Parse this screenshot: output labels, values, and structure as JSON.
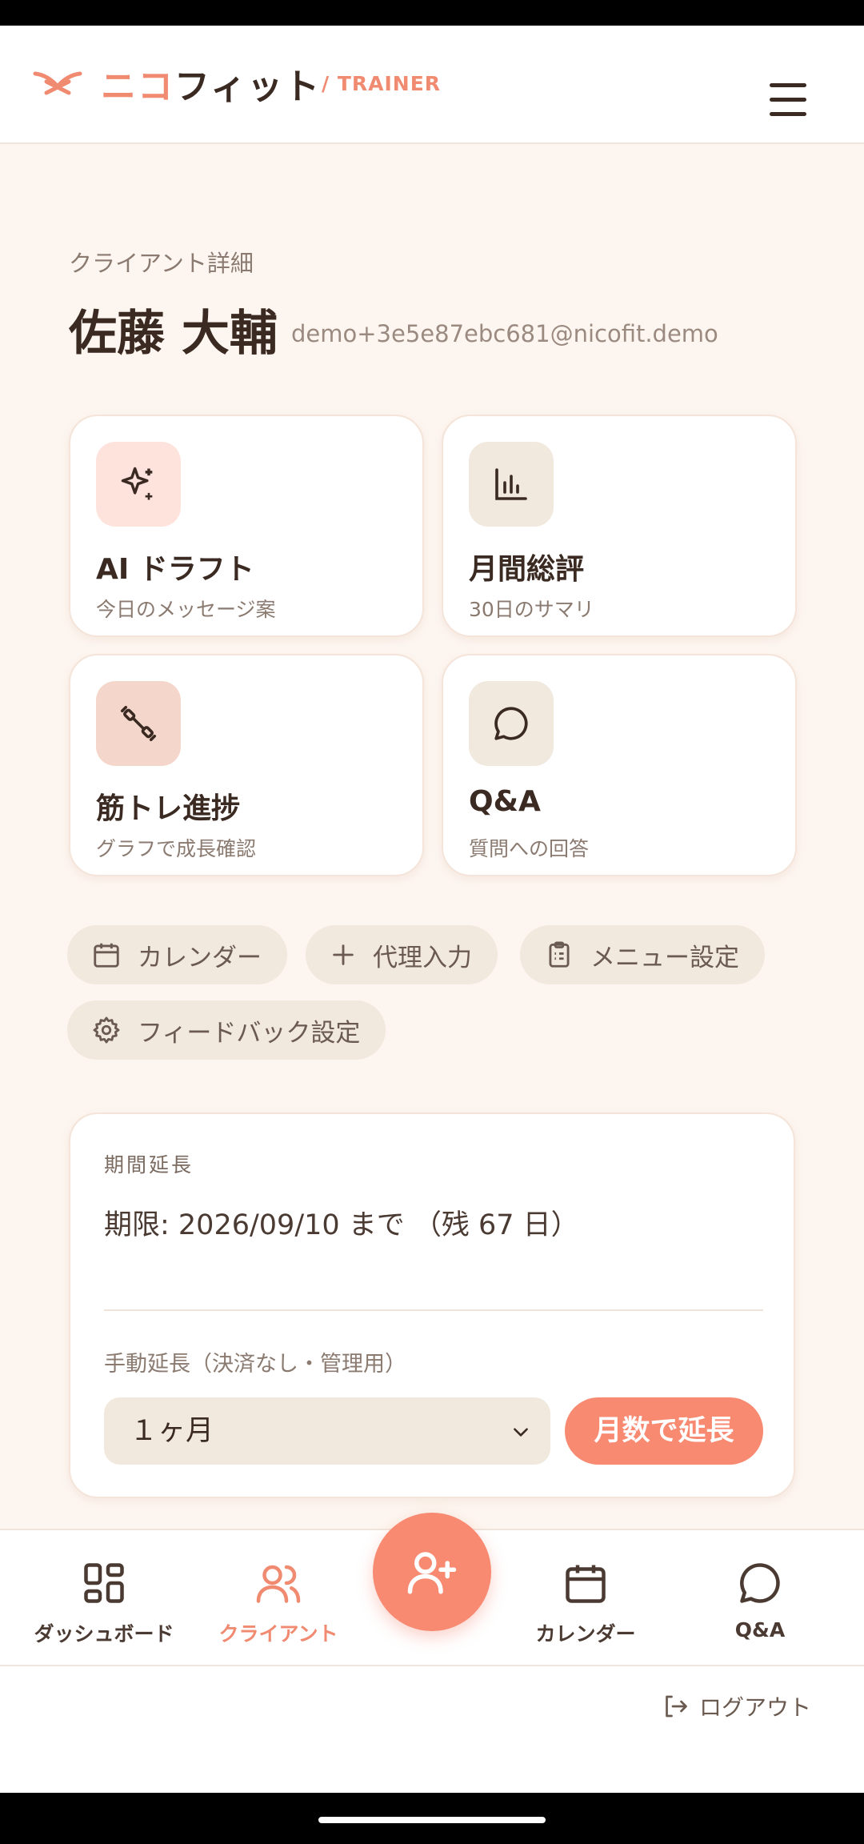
{
  "header": {
    "brand_accent": "ニコ",
    "brand_main": "フィット",
    "role": "/ TRAINER"
  },
  "client": {
    "eyebrow": "クライアント詳細",
    "name": "佐藤 大輔",
    "email": "demo+3e5e87ebc681@nicofit.demo"
  },
  "cards": [
    {
      "title": "AI ドラフト",
      "subtitle": "今日のメッセージ案",
      "icon": "sparkles-icon"
    },
    {
      "title": "月間総評",
      "subtitle": "30日のサマリ",
      "icon": "bar-chart-icon"
    },
    {
      "title": "筋トレ進捗",
      "subtitle": "グラフで成長確認",
      "icon": "dumbbell-icon"
    },
    {
      "title": "Q&A",
      "subtitle": "質問への回答",
      "icon": "chat-bubble-icon"
    }
  ],
  "chips": [
    {
      "label": "カレンダー",
      "icon": "calendar-icon"
    },
    {
      "label": "代理入力",
      "icon": "plus-icon"
    },
    {
      "label": "メニュー設定",
      "icon": "clipboard-icon"
    },
    {
      "label": "フィードバック設定",
      "icon": "gear-icon"
    }
  ],
  "extension": {
    "title": "期間延長",
    "deadline": "期限: 2026/09/10 まで （残 67 日）",
    "manual_label": "手動延長（決済なし・管理用）",
    "select_value": "１ヶ月",
    "button": "月数で延長"
  },
  "nav": [
    {
      "label": "ダッシュボード",
      "icon": "dashboard-icon",
      "active": false
    },
    {
      "label": "クライアント",
      "icon": "users-icon",
      "active": true
    },
    {
      "label": "カレンダー",
      "icon": "calendar-icon",
      "active": false
    },
    {
      "label": "Q&A",
      "icon": "chat-bubble-icon",
      "active": false
    }
  ],
  "fab_icon": "add-user-icon",
  "logout": "ログアウト",
  "colors": {
    "accent": "#f88a72",
    "background": "#fdf6f0",
    "text": "#3a2a22",
    "chip": "#f1e8de"
  }
}
